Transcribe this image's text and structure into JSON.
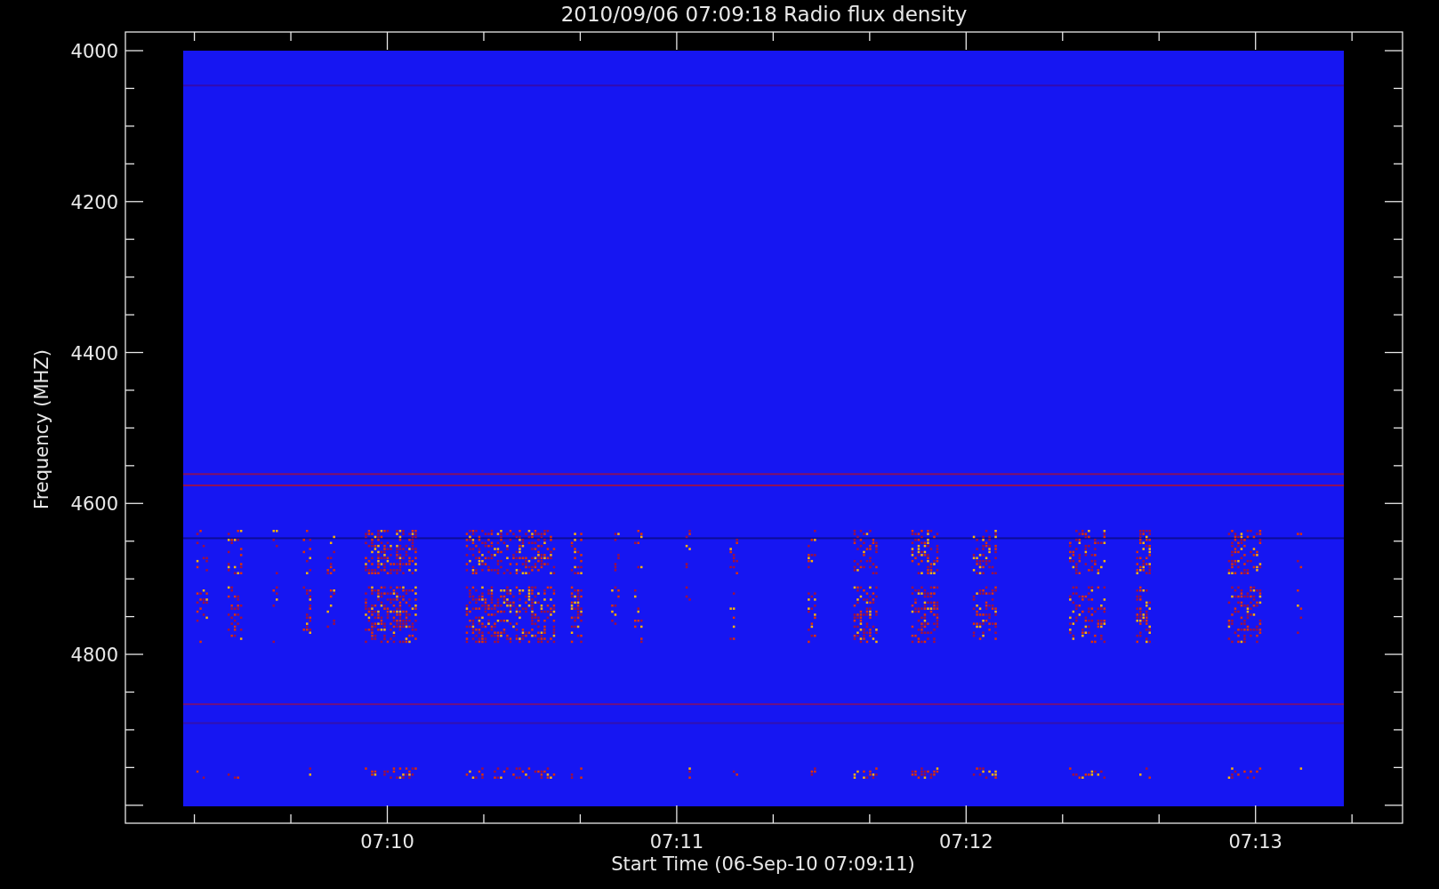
{
  "plot": {
    "title": "2010/09/06 07:09:18 Radio flux density",
    "y_axis": {
      "label": "Frequency (MHZ)",
      "ticks": [
        "4000",
        "4200",
        "4400",
        "4600",
        "4800"
      ]
    },
    "x_axis": {
      "label": "Start Time (06-Sep-10 07:09:11)",
      "ticks": [
        "07:10",
        "07:11",
        "07:12",
        "07:13"
      ]
    }
  }
}
